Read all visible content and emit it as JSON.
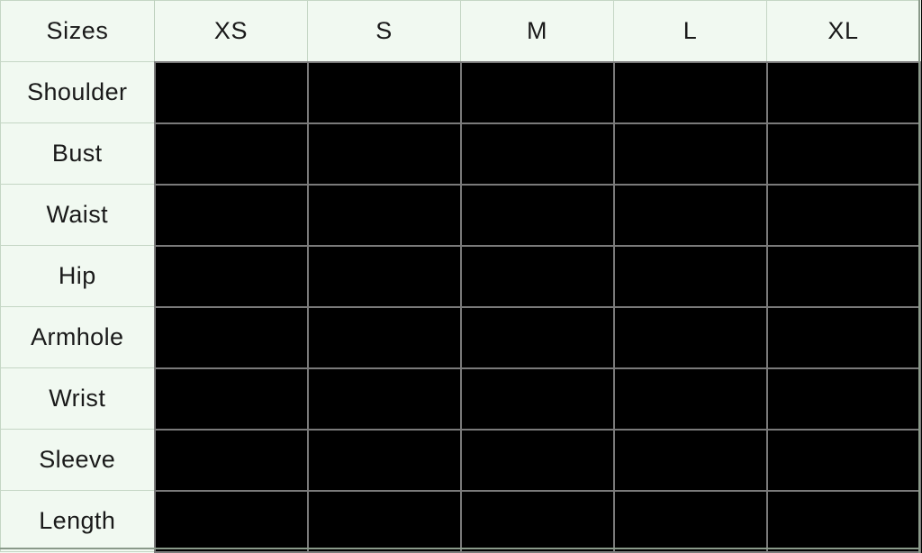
{
  "table": {
    "corner_label": "Sizes",
    "size_columns": [
      "XS",
      "S",
      "M",
      "L",
      "XL"
    ],
    "measurement_rows": [
      "Shoulder",
      "Bust",
      "Waist",
      "Hip",
      "Armhole",
      "Wrist",
      "Sleeve",
      "Length"
    ],
    "cells": [
      [
        "",
        "",
        "",
        "",
        ""
      ],
      [
        "",
        "",
        "",
        "",
        ""
      ],
      [
        "",
        "",
        "",
        "",
        ""
      ],
      [
        "",
        "",
        "",
        "",
        ""
      ],
      [
        "",
        "",
        "",
        "",
        ""
      ],
      [
        "",
        "",
        "",
        "",
        ""
      ],
      [
        "",
        "",
        "",
        "",
        ""
      ],
      [
        "",
        "",
        "",
        "",
        ""
      ]
    ]
  },
  "colors": {
    "header_background": "#f1f9f1",
    "header_text": "#1a1a1a",
    "label_background": "#f1f9f1",
    "label_text": "#1a1a1a",
    "cell_background": "#000000",
    "cell_gridline": "#7a7a7a",
    "label_gridline": "#c5d6c5",
    "page_background": "#000000"
  }
}
